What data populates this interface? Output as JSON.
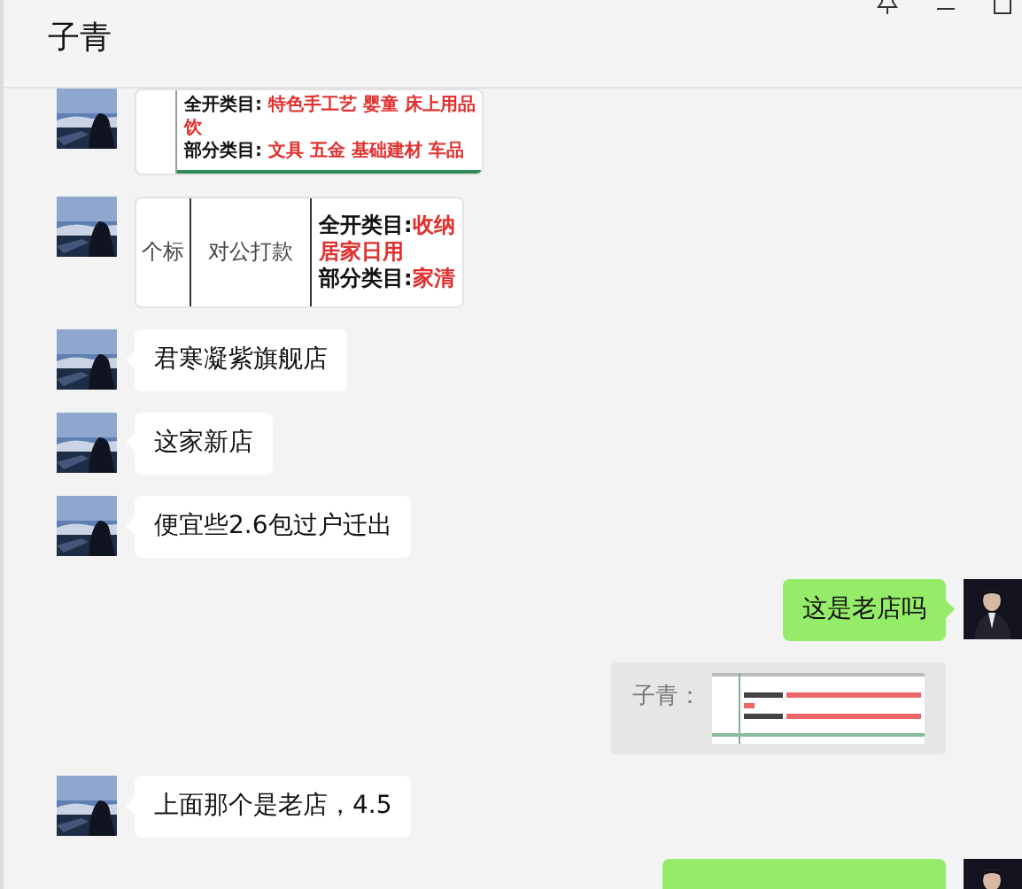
{
  "window": {
    "title": "子青"
  },
  "messages": [
    {
      "kind": "sheet",
      "outgoing": false,
      "lines": [
        {
          "label": "全开类目: ",
          "value": "特色手工艺 婴童 床上用品"
        },
        {
          "value": "饮"
        },
        {
          "label": "部分类目: ",
          "value": "文具 五金 基础建材 车品"
        }
      ]
    },
    {
      "kind": "sheet",
      "outgoing": false,
      "columns": [
        "个标",
        "对公打款"
      ],
      "lines": [
        {
          "label": "全开类目:",
          "value": "收纳"
        },
        {
          "value": "居家日用"
        },
        {
          "label": "部分类目:",
          "value": "家清"
        }
      ]
    },
    {
      "kind": "text",
      "outgoing": false,
      "text": "君寒凝紫旗舰店"
    },
    {
      "kind": "text",
      "outgoing": false,
      "text": "这家新店"
    },
    {
      "kind": "text",
      "outgoing": false,
      "text": "便宜些2.6包过户迁出"
    },
    {
      "kind": "text",
      "outgoing": true,
      "text": "这是老店吗"
    },
    {
      "kind": "quote",
      "outgoing": true,
      "sender": "子青："
    },
    {
      "kind": "text",
      "outgoing": false,
      "text": "上面那个是老店，4.5"
    },
    {
      "kind": "text",
      "outgoing": true
    }
  ]
}
